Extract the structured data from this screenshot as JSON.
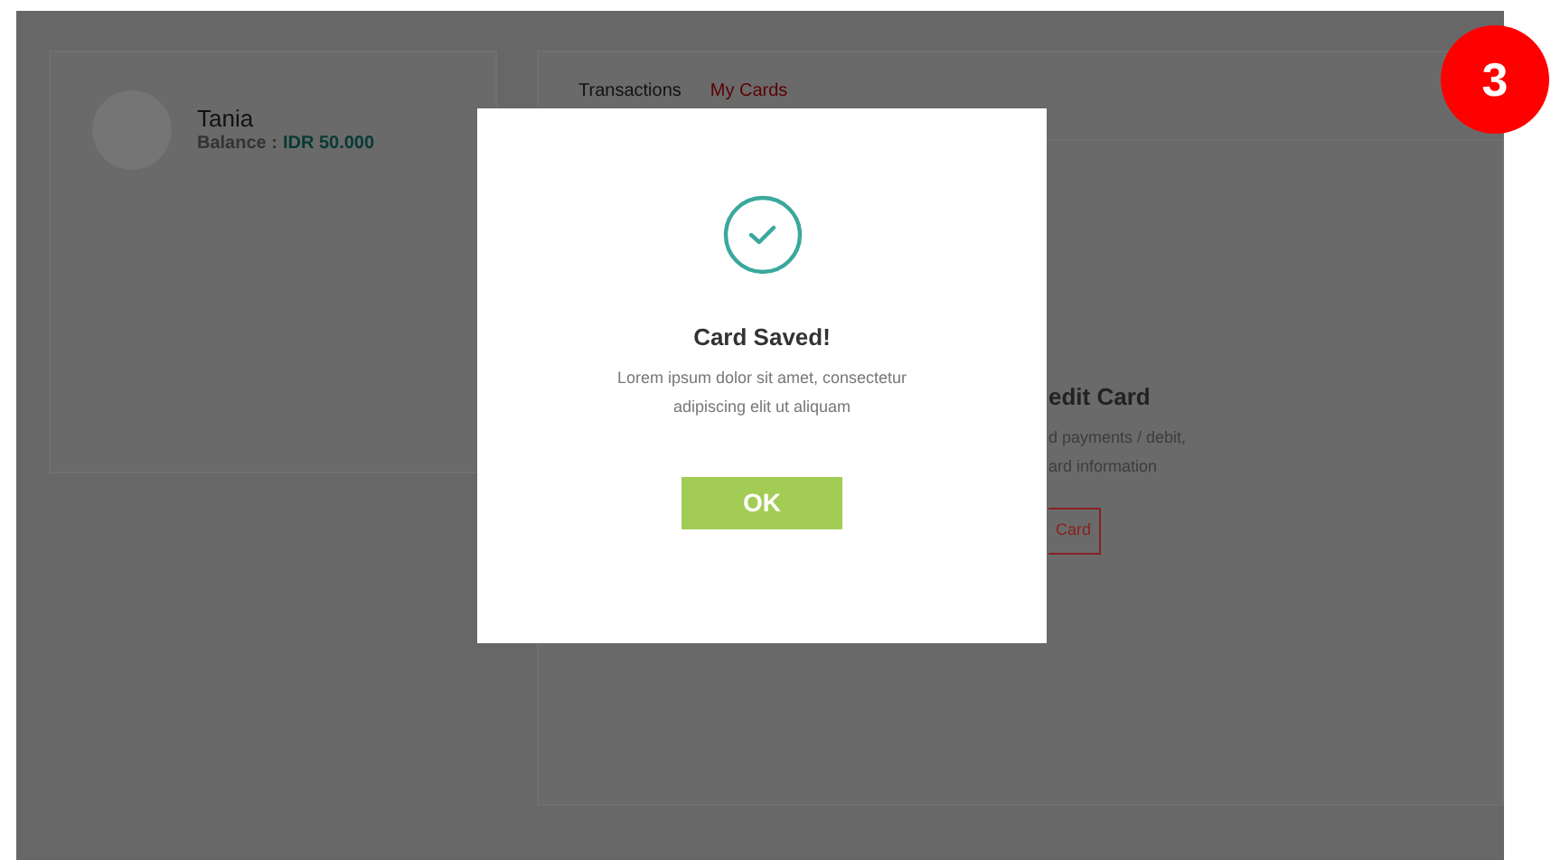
{
  "profile": {
    "name": "Tania",
    "balance_label": "Balance :",
    "balance_value": "IDR 50.000"
  },
  "tabs": [
    {
      "label": "Transactions",
      "selected": false
    },
    {
      "label": "My Cards",
      "selected": true
    }
  ],
  "card_section": {
    "title": "edit Card",
    "description_lines": [
      "d payments / debit,",
      "ard information"
    ],
    "button": "Card"
  },
  "dialog": {
    "title": "Card Saved!",
    "message_lines": [
      "Lorem ipsum dolor sit amet, consectetur",
      "adipiscing elit ut aliquam"
    ],
    "button": "OK"
  },
  "step_badge": "3"
}
